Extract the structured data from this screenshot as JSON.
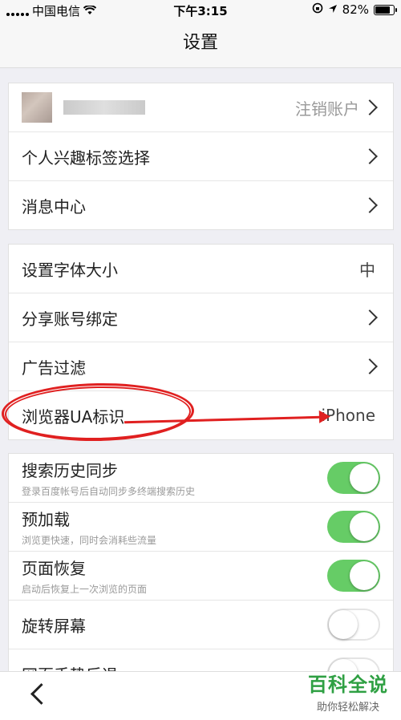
{
  "status": {
    "carrier": "中国电信",
    "time": "下午3:15",
    "battery": "82%"
  },
  "nav": {
    "title": "设置"
  },
  "account": {
    "logout_label": "注销账户"
  },
  "group1": [
    {
      "label": "个人兴趣标签选择"
    },
    {
      "label": "消息中心"
    }
  ],
  "group2": [
    {
      "label": "设置字体大小",
      "value": "中"
    },
    {
      "label": "分享账号绑定"
    },
    {
      "label": "广告过滤"
    },
    {
      "label": "浏览器UA标识",
      "value": "iPhone"
    }
  ],
  "toggles": [
    {
      "title": "搜索历史同步",
      "sub": "登录百度帐号后自动同步多终端搜索历史",
      "on": true
    },
    {
      "title": "预加载",
      "sub": "浏览更快速，同时会消耗些流量",
      "on": true
    },
    {
      "title": "页面恢复",
      "sub": "启动后恢复上一次浏览的页面",
      "on": true
    },
    {
      "title": "旋转屏幕",
      "sub": "",
      "on": false
    },
    {
      "title": "网页手势后退",
      "sub": "",
      "on": false
    }
  ],
  "watermark": {
    "big": "百科全说",
    "small": "助你轻松解决"
  },
  "colors": {
    "toggle_on": "#66cc66",
    "annotation": "#e02020",
    "watermark": "#2fa043"
  }
}
